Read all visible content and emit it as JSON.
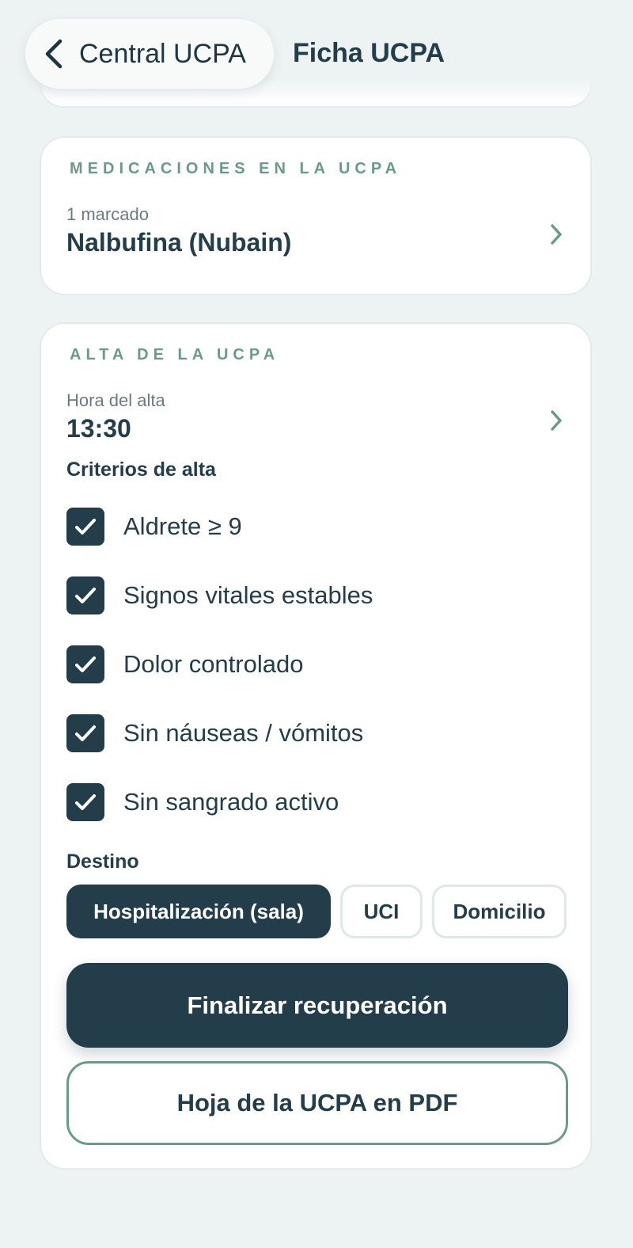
{
  "header": {
    "back_label": "Central UCPA",
    "title": "Ficha UCPA"
  },
  "medications": {
    "section_title": "MEDICACIONES EN LA UCPA",
    "count_label": "1 marcado",
    "value": "Nalbufina (Nubain)"
  },
  "discharge": {
    "section_title": "ALTA DE LA UCPA",
    "time_label": "Hora del alta",
    "time_value": "13:30",
    "criteria_title": "Criterios de alta",
    "criteria": [
      {
        "label": "Aldrete ≥ 9",
        "checked": true
      },
      {
        "label": "Signos vitales estables",
        "checked": true
      },
      {
        "label": "Dolor controlado",
        "checked": true
      },
      {
        "label": "Sin náuseas / vómitos",
        "checked": true
      },
      {
        "label": "Sin sangrado activo",
        "checked": true
      }
    ],
    "destination_title": "Destino",
    "destinations": [
      {
        "label": "Hospitalización (sala)",
        "selected": true
      },
      {
        "label": "UCI",
        "selected": false
      },
      {
        "label": "Domicilio",
        "selected": false
      }
    ],
    "finalize_label": "Finalizar recuperación",
    "pdf_label": "Hoja de la UCPA en PDF"
  },
  "colors": {
    "background": "#edf3f3",
    "primary": "#233d4b",
    "accent": "#6a9a8a",
    "card": "#ffffff"
  },
  "icons": {
    "back": "chevron-left-icon",
    "row": "chevron-right-icon",
    "check": "checkmark-icon"
  }
}
